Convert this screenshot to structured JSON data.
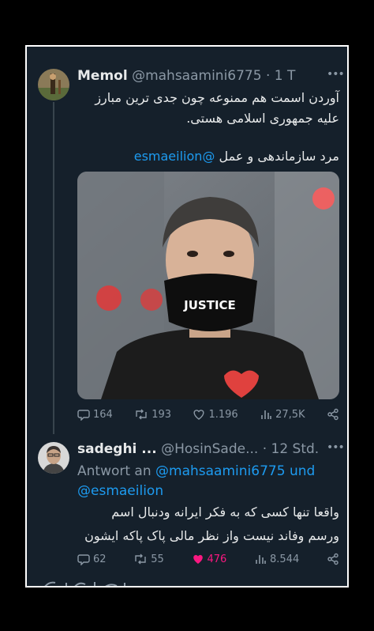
{
  "tweet": {
    "name": "Memol",
    "handle": "@mahsaamini6775",
    "time": "· 1 T",
    "text_line1": "آوردن اسمت هم ممنوعه چون جدی ترین مبارز",
    "text_line2": "علیه جمهوری اسلامی هستی.",
    "text_line3": "مرد سازماندهی و عمل",
    "mention": "@esmaeilion",
    "mask_text": "JUSTICE",
    "stats": {
      "replies": "164",
      "retweets": "193",
      "likes": "1.196",
      "views": "27,5K"
    }
  },
  "reply": {
    "name": "sadeghi ...",
    "handle": "@HosinSade...",
    "time": "· 12 Std.",
    "reply_prefix": "Antwort an",
    "reply_user1": "@mahsaamini6775",
    "reply_and": "und",
    "reply_user2": "@esmaeilion",
    "text_line1": "واقعا  تنها کسی که به فکر ایرانه ودنبال اسم",
    "text_line2": "ورسم وفاند نیست واز نظر مالی پاک پاکه ایشون",
    "stats": {
      "replies": "62",
      "retweets": "55",
      "likes": "476",
      "views": "8.544"
    }
  },
  "colors": {
    "background": "#15202b",
    "link": "#1d9bf0",
    "like": "#f91880",
    "muted": "#8b98a5"
  },
  "icons": [
    "more-icon",
    "reply-icon",
    "retweet-icon",
    "like-icon",
    "views-icon",
    "share-icon"
  ]
}
